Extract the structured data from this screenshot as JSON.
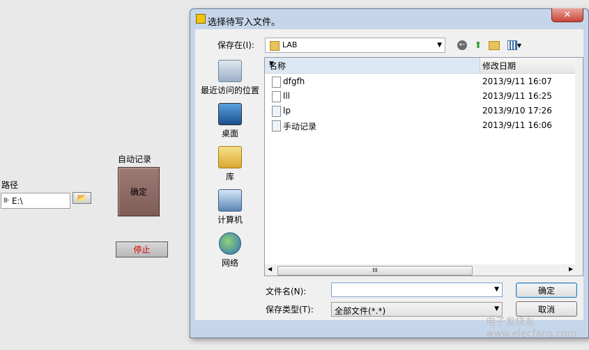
{
  "front_panel": {
    "path_label": "路径",
    "path_value": "E:\\",
    "path_prefix_icon": "path-type-icon",
    "auto_record_label": "自动记录",
    "ok_label": "确定",
    "stop_label": "停止"
  },
  "dialog": {
    "title": "选择待写入文件。",
    "close_label": "✕",
    "save_in_label": "保存在(I):",
    "save_in_value": "LAB",
    "places": [
      {
        "label": "最近访问的位置",
        "icon": "recent-places-icon"
      },
      {
        "label": "桌面",
        "icon": "desktop-icon"
      },
      {
        "label": "库",
        "icon": "libraries-icon"
      },
      {
        "label": "计算机",
        "icon": "computer-icon"
      },
      {
        "label": "网络",
        "icon": "network-icon"
      }
    ],
    "columns": {
      "name": "名称",
      "modified": "修改日期",
      "extra": "ε"
    },
    "files": [
      {
        "name": "dfgfh",
        "modified": "2013/9/11 16:07",
        "extra": "Ž"
      },
      {
        "name": "lll",
        "modified": "2013/9/11 16:25",
        "extra": "Ž"
      },
      {
        "name": "lp",
        "modified": "2013/9/10 17:26",
        "extra": "L"
      },
      {
        "name": "手动记录",
        "modified": "2013/9/11 16:06",
        "extra": "L"
      }
    ],
    "filename_label": "文件名(N):",
    "filename_value": "",
    "filetype_label": "保存类型(T):",
    "filetype_value": "全部文件(*.*)",
    "ok_button": "确定",
    "cancel_button": "取消",
    "scroll_thumb": "III"
  },
  "watermark": "电子发烧友 www.elecfans.com",
  "colors": {
    "dialog_frame": "#c6d6ea",
    "ok_big": "#8b6b65",
    "stop_text": "#d40000"
  }
}
